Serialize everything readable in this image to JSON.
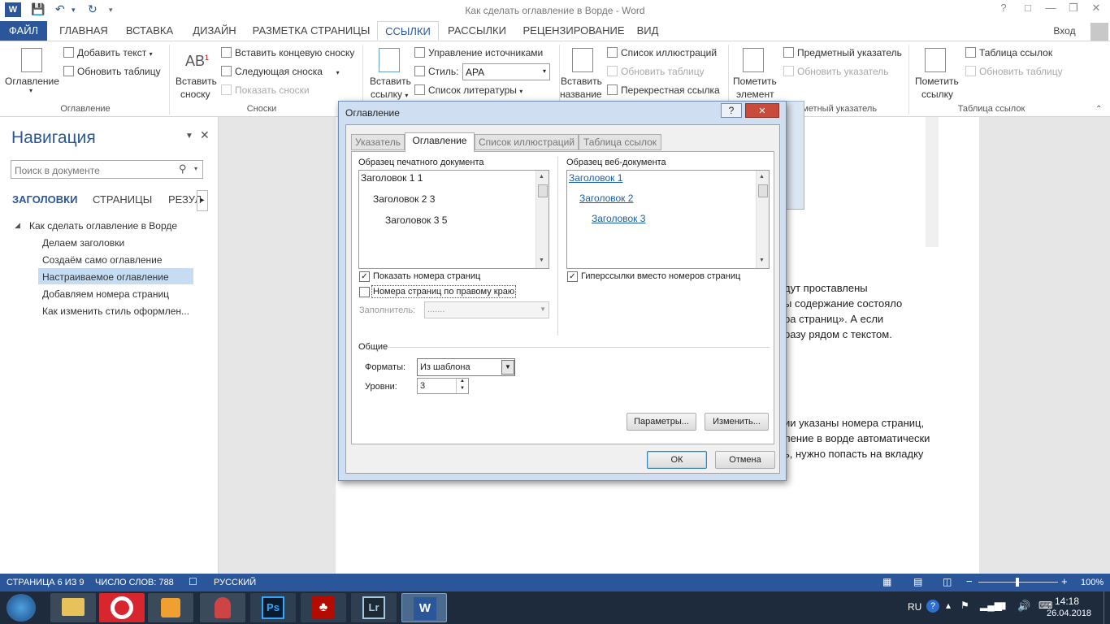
{
  "titlebar": {
    "title": "Как сделать оглавление в Ворде - Word",
    "help": "?",
    "minimize": "—",
    "restore": "❐",
    "close": "✕",
    "word_logo": "W"
  },
  "tabs": {
    "file": "ФАЙЛ",
    "items": [
      "ГЛАВНАЯ",
      "ВСТАВКА",
      "ДИЗАЙН",
      "РАЗМЕТКА СТРАНИЦЫ",
      "ССЫЛКИ",
      "РАССЫЛКИ",
      "РЕЦЕНЗИРОВАНИЕ",
      "ВИД"
    ],
    "active": "ССЫЛКИ",
    "signin": "Вход"
  },
  "ribbon": {
    "toc": {
      "big_label1": "Оглавление",
      "add_text": "Добавить текст",
      "update_table": "Обновить таблицу",
      "group": "Оглавление"
    },
    "footnotes": {
      "insert1": "Вставить",
      "insert2": "сноску",
      "ab": "AB",
      "sup": "1",
      "endnote": "Вставить концевую сноску",
      "next": "Следующая сноска",
      "show": "Показать сноски",
      "group": "Сноски"
    },
    "citations": {
      "insert1": "Вставить",
      "insert2": "ссылку",
      "manage": "Управление источниками",
      "style_label": "Стиль:",
      "style_value": "APA",
      "biblio": "Список литературы"
    },
    "captions": {
      "insert1": "Вставить",
      "insert2": "название",
      "list_ill": "Список иллюстраций",
      "update": "Обновить таблицу",
      "cross": "Перекрестная ссылка"
    },
    "index": {
      "mark1": "Пометить",
      "mark2": "элемент",
      "subject": "Предметный указатель",
      "update": "Обновить указатель",
      "group": "Предметный указатель"
    },
    "toa": {
      "mark1": "Пометить",
      "mark2": "ссылку",
      "table": "Таблица ссылок",
      "update": "Обновить таблицу",
      "group": "Таблица ссылок"
    }
  },
  "nav": {
    "title": "Навигация",
    "search_placeholder": "Поиск в документе",
    "tabs": [
      "ЗАГОЛОВКИ",
      "СТРАНИЦЫ",
      "РЕЗУЛ"
    ],
    "root": "Как сделать оглавление в Ворде",
    "items": [
      "Делаем заголовки",
      "Создаём само оглавление",
      "Настраиваемое оглавление",
      "Добавляем номера страниц",
      "Как изменить стиль оформлен..."
    ],
    "selected_index": 2
  },
  "document": {
    "lines_a": [
      "дут проставлены",
      "ы содержание состояло",
      "ра страниц». А если",
      "разу рядом с текстом."
    ],
    "lines_b": [
      "ии указаны номера страниц,",
      "ление в ворде автоматически",
      "ь, нужно попасть на вкладку"
    ]
  },
  "dialog": {
    "title": "Оглавление",
    "help": "?",
    "close": "✕",
    "tabs": [
      "Указатель",
      "Оглавление",
      "Список иллюстраций",
      "Таблица ссылок"
    ],
    "active_tab": "Оглавление",
    "print_preview_label": "Образец печатного документа",
    "print_lines": [
      "Заголовок 1 1",
      "Заголовок 2 3",
      "Заголовок 3 5"
    ],
    "web_preview_label": "Образец веб-документа",
    "web_lines": [
      "Заголовок 1",
      "Заголовок 2",
      "Заголовок 3"
    ],
    "show_page_numbers": "Показать номера страниц",
    "show_page_numbers_checked": true,
    "right_align": "Номера страниц по правому краю",
    "right_align_checked": false,
    "tab_leader_label": "Заполнитель:",
    "tab_leader_value": ".......",
    "hyperlinks": "Гиперссылки вместо номеров страниц",
    "hyperlinks_checked": true,
    "general": "Общие",
    "formats_label": "Форматы:",
    "formats_value": "Из шаблона",
    "levels_label": "Уровни:",
    "levels_value": "3",
    "options_btn": "Параметры...",
    "modify_btn": "Изменить...",
    "ok": "ОК",
    "cancel": "Отмена"
  },
  "status": {
    "page": "СТРАНИЦА 6 ИЗ 9",
    "words": "ЧИСЛО СЛОВ: 788",
    "lang": "РУССКИЙ",
    "zoom": "100%",
    "zoom_minus": "−",
    "zoom_plus": "+"
  },
  "taskbar": {
    "lang": "RU",
    "time": "14:18",
    "date": "26.04.2018",
    "apps": [
      "Ps",
      "Lr",
      "W"
    ]
  },
  "colors": {
    "accent": "#2b579a",
    "taskbar": "#1d2b3c",
    "link": "#1b5fa8"
  }
}
